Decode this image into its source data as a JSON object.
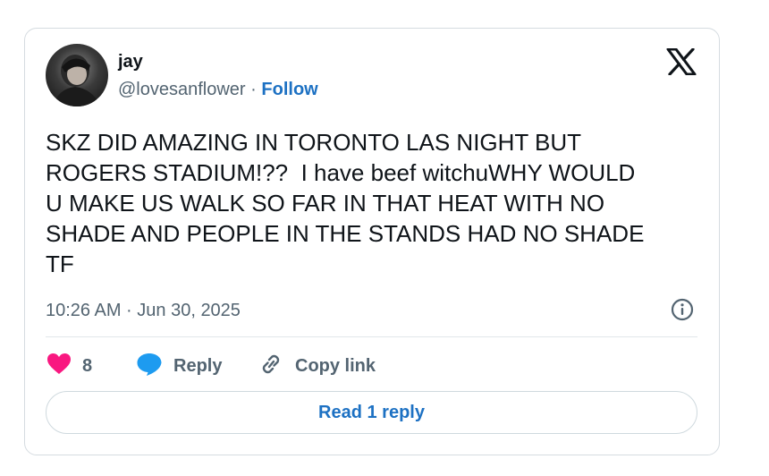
{
  "author": {
    "name": "jay",
    "handle": "@lovesanflower",
    "separator": "·",
    "follow_label": "Follow"
  },
  "tweet": {
    "text": "SKZ DID AMAZING IN TORONTO LAS NIGHT BUT\nROGERS STADIUM!??  I have beef witchuWHY WOULD\nU MAKE US WALK SO FAR IN THAT HEAT WITH NO\nSHADE AND PEOPLE IN THE STANDS HAD NO SHADE\nTF",
    "timestamp": "10:26 AM · Jun 30, 2025"
  },
  "actions": {
    "like_count": "8",
    "reply_label": "Reply",
    "copy_label": "Copy link"
  },
  "read_replies_label": "Read 1 reply",
  "colors": {
    "accent": "#1d71c3",
    "like": "#f91880",
    "reply_icon": "#1d9bf0",
    "muted": "#536471"
  },
  "icons": {
    "platform": "x-logo-icon",
    "info": "info-icon",
    "like": "heart-icon",
    "reply": "speech-bubble-icon",
    "copy": "link-icon"
  }
}
